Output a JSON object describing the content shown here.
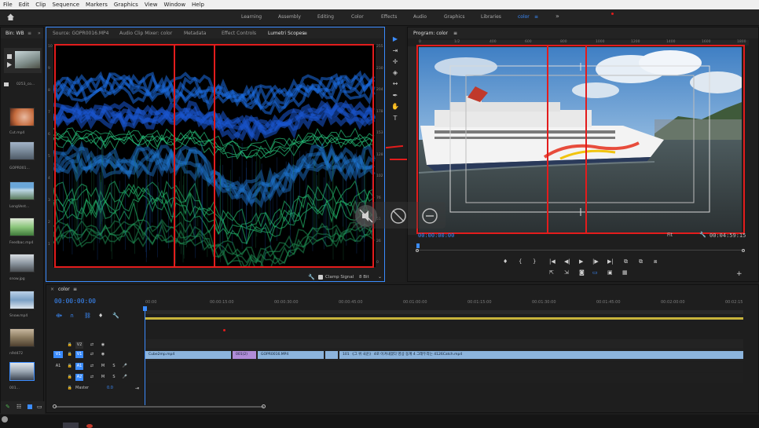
{
  "menu": [
    "File",
    "Edit",
    "Clip",
    "Sequence",
    "Markers",
    "Graphics",
    "View",
    "Window",
    "Help"
  ],
  "workspaces": [
    "Learning",
    "Assembly",
    "Editing",
    "Color",
    "Effects",
    "Audio",
    "Graphics",
    "Libraries",
    "color"
  ],
  "workspace_active": "color",
  "project_panel": {
    "title": "Bin: WB",
    "folder_label": "0253_co...",
    "items": [
      {
        "label": "Cut.mp4"
      },
      {
        "label": "GOPR001..."
      },
      {
        "label": "LongVent..."
      },
      {
        "label": "Feedbac.mp4"
      },
      {
        "label": "snow.jpg"
      },
      {
        "label": "Snow.mp4"
      },
      {
        "label": "n9d472"
      },
      {
        "label": "001..."
      }
    ]
  },
  "source_tabs": [
    {
      "label": "Source: GOPR0016.MP4"
    },
    {
      "label": "Audio Clip Mixer: color"
    },
    {
      "label": "Metadata"
    },
    {
      "label": "Effect Controls"
    },
    {
      "label": "Lumetri Scopes"
    }
  ],
  "scope": {
    "clamp_signal_label": "Clamp Signal",
    "bit_depth": "8 Bit",
    "left_scale": [
      "10",
      "9",
      "8",
      "7",
      "6",
      "5",
      "4",
      "3",
      "2",
      "1"
    ],
    "right_scale": [
      "255",
      "230",
      "204",
      "178",
      "153",
      "128",
      "102",
      "76",
      "51",
      "26",
      "0"
    ]
  },
  "program": {
    "title": "Program: color",
    "timecode": "00:00:00:00",
    "fit_label": "Fit",
    "end_timecode": "00:04:59:15",
    "ruler": [
      "0",
      "1/2",
      "400",
      "600",
      "800",
      "1000",
      "1200",
      "1400",
      "1600",
      "1800"
    ]
  },
  "overlay_icons": [
    "mute-icon",
    "ban-icon",
    "minus-circle-icon"
  ],
  "timeline": {
    "sequence_name": "color",
    "timecode": "00:00:00:00",
    "ruler": [
      "00:00",
      "00:00:15:00",
      "00:00:30:00",
      "00:00:45:00",
      "00:01:00:00",
      "00:01:15:00",
      "00:01:30:00",
      "00:01:45:00",
      "00:02:00:00",
      "00:02:15"
    ],
    "video_tracks": [
      "V2",
      "V1"
    ],
    "audio_tracks": [
      "A1",
      "A2"
    ],
    "master_label": "Master",
    "master_value": "0.0",
    "clips": [
      {
        "label": "Cube2mp.mp4"
      },
      {
        "label": "001(2)"
      },
      {
        "label": "GOPR0016.MP4"
      },
      {
        "label": "101 《그 위 국운》 4로 이겨내겠다 영상 동계 4 그래두라는 4126Catch.mp4"
      }
    ]
  },
  "colors": {
    "accent": "#3b8cff",
    "highlight_red": "#e31c1c",
    "clip_blue": "#8cb4dc",
    "clip_purple": "#b08cd8"
  }
}
